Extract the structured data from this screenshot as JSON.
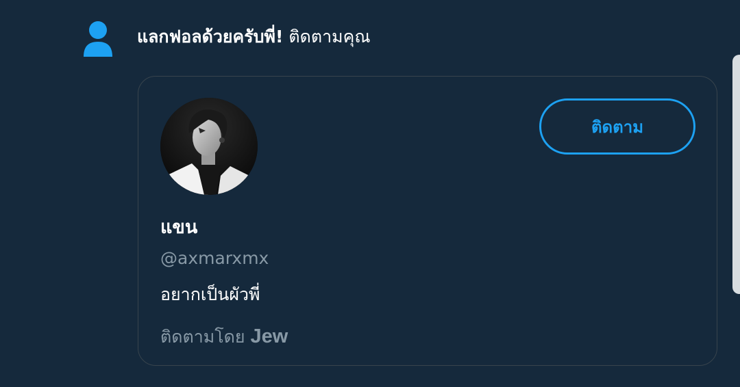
{
  "notification": {
    "icon": "person-icon",
    "actor": "แลกฟอลด้วยครับพี่!",
    "action": " ติดตามคุณ"
  },
  "user_card": {
    "avatar": "user-avatar",
    "display_name": "แขน",
    "handle": "@axmarxmx",
    "bio": "อยากเป็นผัวพี่",
    "follow_button_label": "ติดตาม",
    "followed_by_prefix": "ติดตามโดย",
    "followed_by_name": "Jew"
  },
  "colors": {
    "background": "#15293c",
    "accent": "#1da1f2",
    "border": "#38444d",
    "secondary_text": "#8899a6",
    "primary_text": "#ffffff"
  }
}
